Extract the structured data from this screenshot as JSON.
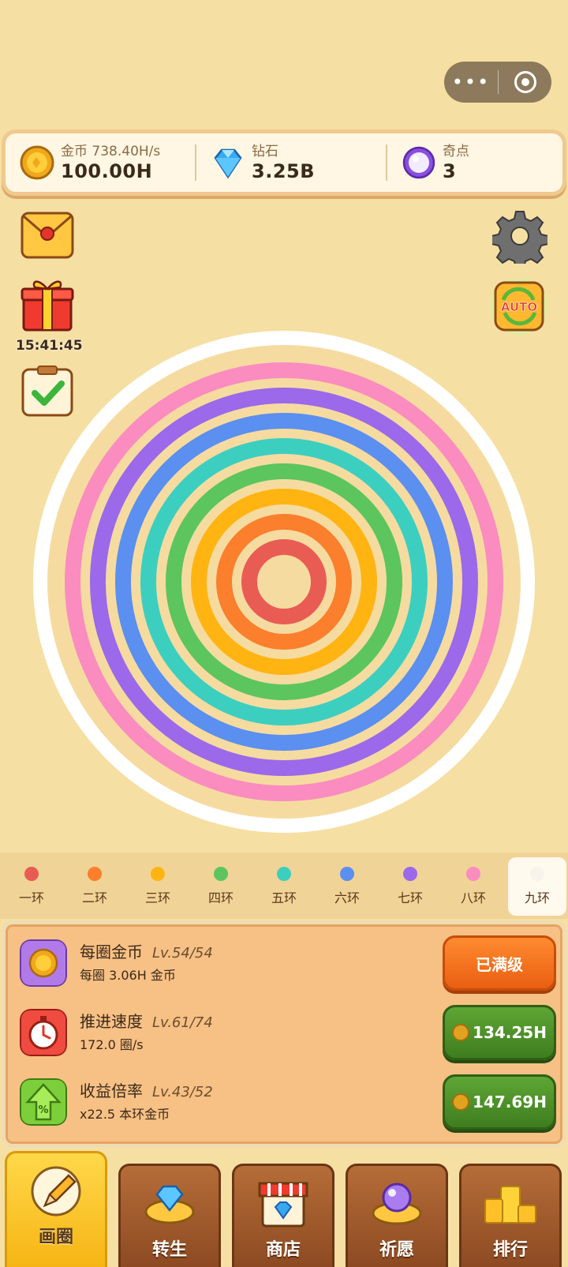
{
  "capsule": {
    "more_label": "•••"
  },
  "resources": {
    "coin": {
      "label": "金币",
      "rate": "738.40H/s",
      "value": "100.00H"
    },
    "gem": {
      "label": "钻石",
      "value": "3.25B"
    },
    "star": {
      "label": "奇点",
      "value": "3"
    }
  },
  "side": {
    "gift_timer": "15:41:45",
    "auto_label": "AUTO"
  },
  "rings": {
    "colors": [
      "#e95c54",
      "#fb7f2c",
      "#ffb412",
      "#5cc55e",
      "#3ccfc0",
      "#5b8ff0",
      "#9b69ea",
      "#fa8cbf"
    ]
  },
  "tabs": [
    {
      "label": "一环",
      "color": "#e95c54"
    },
    {
      "label": "二环",
      "color": "#fb7f2c"
    },
    {
      "label": "三环",
      "color": "#ffb412"
    },
    {
      "label": "四环",
      "color": "#5cc55e"
    },
    {
      "label": "五环",
      "color": "#3ccfc0"
    },
    {
      "label": "六环",
      "color": "#5b8ff0"
    },
    {
      "label": "七环",
      "color": "#9b69ea"
    },
    {
      "label": "八环",
      "color": "#fa8cbf"
    },
    {
      "label": "九环",
      "color": "#f8f4ec"
    }
  ],
  "upgrades": [
    {
      "title": "每圈金币",
      "level": "Lv.54/54",
      "desc": "每圈 3.06H 金币",
      "button": "已满级"
    },
    {
      "title": "推进速度",
      "level": "Lv.61/74",
      "desc": "172.0 圈/s",
      "button": "134.25H"
    },
    {
      "title": "收益倍率",
      "level": "Lv.43/52",
      "desc": "x22.5 本环金币",
      "button": "147.69H"
    }
  ],
  "nav": [
    {
      "label": "画圈"
    },
    {
      "label": "转生"
    },
    {
      "label": "商店"
    },
    {
      "label": "祈愿"
    },
    {
      "label": "排行"
    }
  ]
}
